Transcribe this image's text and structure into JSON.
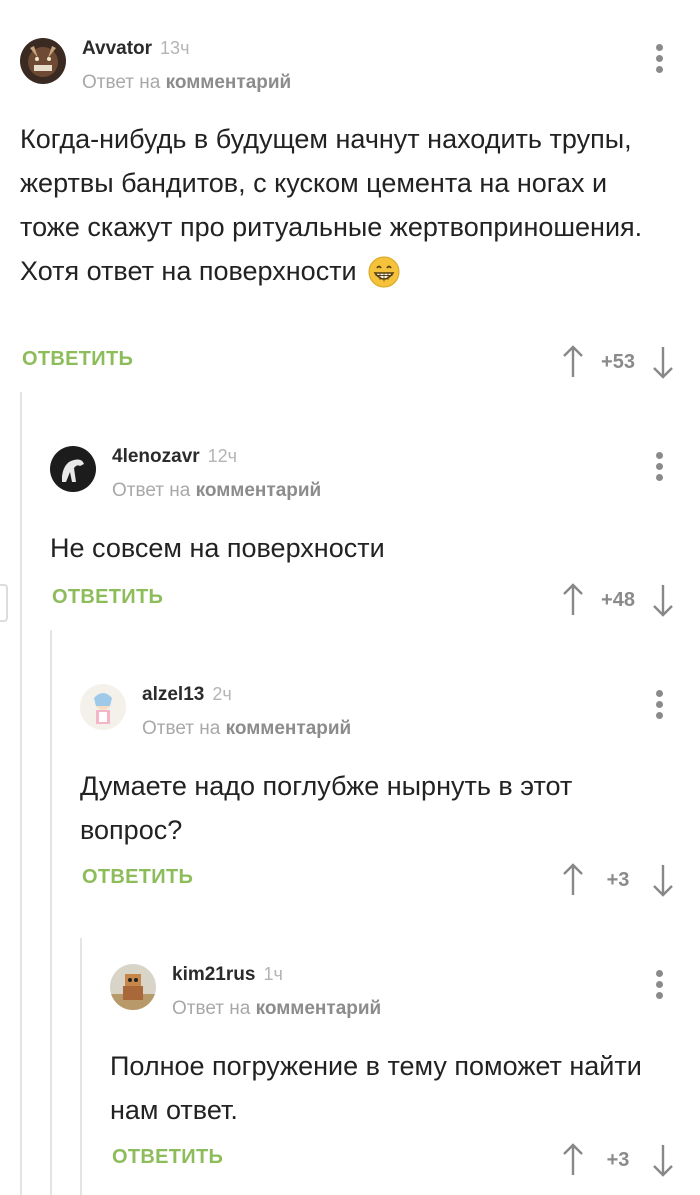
{
  "comments": [
    {
      "author": "Avvator",
      "time": "13ч",
      "reply_prefix": "Ответ на",
      "reply_target": "комментарий",
      "text": "Когда-нибудь в будущем начнут находить трупы, жертвы бандитов, с куском цемента на ногах и тоже скажут про ритуальные жертвоприношения. Хотя ответ на поверхности",
      "emoji": "grinning-face",
      "reply_label": "ОТВЕТИТЬ",
      "score": "+53"
    },
    {
      "author": "4lenozavr",
      "time": "12ч",
      "reply_prefix": "Ответ на",
      "reply_target": "комментарий",
      "text": "Не совсем на поверхности",
      "reply_label": "ОТВЕТИТЬ",
      "score": "+48"
    },
    {
      "author": "alzel13",
      "time": "2ч",
      "reply_prefix": "Ответ на",
      "reply_target": "комментарий",
      "text": "Думаете надо поглубже нырнуть в этот вопрос?",
      "reply_label": "ОТВЕТИТЬ",
      "score": "+3"
    },
    {
      "author": "kim21rus",
      "time": "1ч",
      "reply_prefix": "Ответ на",
      "reply_target": "комментарий",
      "text": "Полное погружение в тему поможет найти нам ответ.",
      "reply_label": "ОТВЕТИТЬ",
      "score": "+3"
    }
  ],
  "colors": {
    "accent_green": "#8dbd5a",
    "muted_gray": "#a8a8a8",
    "thread_line": "#e4e4e4"
  }
}
